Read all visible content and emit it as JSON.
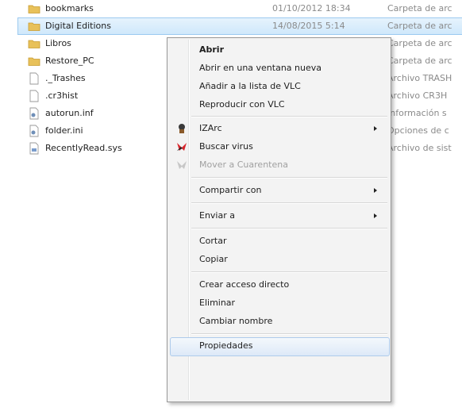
{
  "files": [
    {
      "name": "bookmarks",
      "date": "01/10/2012 18:34",
      "type": "Carpeta de arc",
      "icon": "folder-icon"
    },
    {
      "name": "Digital Editions",
      "date": "14/08/2015 5:14",
      "type": "Carpeta de arc",
      "icon": "folder-icon",
      "selected": true
    },
    {
      "name": "Libros",
      "date": "",
      "type": "Carpeta de arc",
      "icon": "folder-icon"
    },
    {
      "name": "Restore_PC",
      "date": "",
      "type": "Carpeta de arc",
      "icon": "folder-icon"
    },
    {
      "name": "._Trashes",
      "date": "",
      "type": "Archivo TRASH",
      "icon": "file-icon"
    },
    {
      "name": ".cr3hist",
      "date": "",
      "type": "Archivo CR3H",
      "icon": "file-icon"
    },
    {
      "name": "autorun.inf",
      "date": "",
      "type": "Información s",
      "icon": "settings-file-icon"
    },
    {
      "name": "folder.ini",
      "date": "",
      "type": "Opciones de c",
      "icon": "settings-file-icon"
    },
    {
      "name": "RecentlyRead.sys",
      "date": "",
      "type": "Archivo de sist",
      "icon": "system-file-icon"
    }
  ],
  "context_menu": {
    "items": [
      {
        "label": "Abrir",
        "bold": true
      },
      {
        "label": "Abrir en una ventana nueva"
      },
      {
        "label": "Añadir a la lista de VLC"
      },
      {
        "label": "Reproducir con VLC"
      },
      {
        "label": "IZArc",
        "icon": "izarc-icon",
        "submenu": true
      },
      {
        "label": "Buscar virus",
        "icon": "antivirus-icon"
      },
      {
        "label": "Mover a Cuarentena",
        "icon": "quarantine-icon",
        "disabled": true
      },
      {
        "label": "Compartir con",
        "submenu": true
      },
      {
        "label": "Enviar a",
        "submenu": true
      },
      {
        "label": "Cortar"
      },
      {
        "label": "Copiar"
      },
      {
        "label": "Crear acceso directo"
      },
      {
        "label": "Eliminar"
      },
      {
        "label": "Cambiar nombre"
      },
      {
        "label": "Propiedades",
        "hover": true
      }
    ]
  },
  "colors": {
    "selection": "#cce8ff",
    "menu_background": "#f3f3f3",
    "folder": "#e8c15a",
    "secondary_text": "#8a8a8a"
  }
}
